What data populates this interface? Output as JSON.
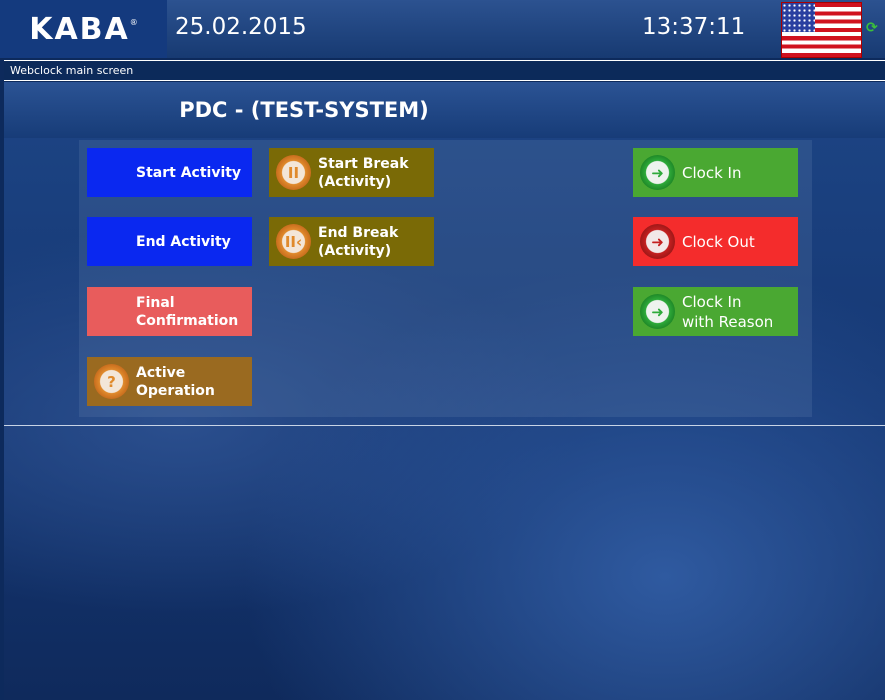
{
  "header": {
    "logo": "KABA",
    "date": "25.02.2015",
    "time": "13:37:11",
    "language_flag": "us-flag-icon",
    "refresh_icon": "refresh-icon"
  },
  "subbar": {
    "title": "Webclock main screen"
  },
  "main": {
    "title": "PDC - (TEST-SYSTEM)",
    "buttons": {
      "start_activity": "Start Activity",
      "end_activity": "End Activity",
      "final_confirmation_1": "Final",
      "final_confirmation_2": "Confirmation",
      "active_operation_1": "Active",
      "active_operation_2": "Operation",
      "start_break_1": "Start Break",
      "start_break_2": "(Activity)",
      "end_break_1": "End Break",
      "end_break_2": "(Activity)",
      "clock_in": "Clock In",
      "clock_out": "Clock Out",
      "clock_in_reason_1": "Clock In",
      "clock_in_reason_2": "with Reason"
    },
    "colors": {
      "blue": "#0a28f0",
      "salmon": "#e85c5c",
      "brown": "#9a6a20",
      "olive": "#7a6a06",
      "green": "#4aa832",
      "red": "#f42c2c"
    }
  }
}
